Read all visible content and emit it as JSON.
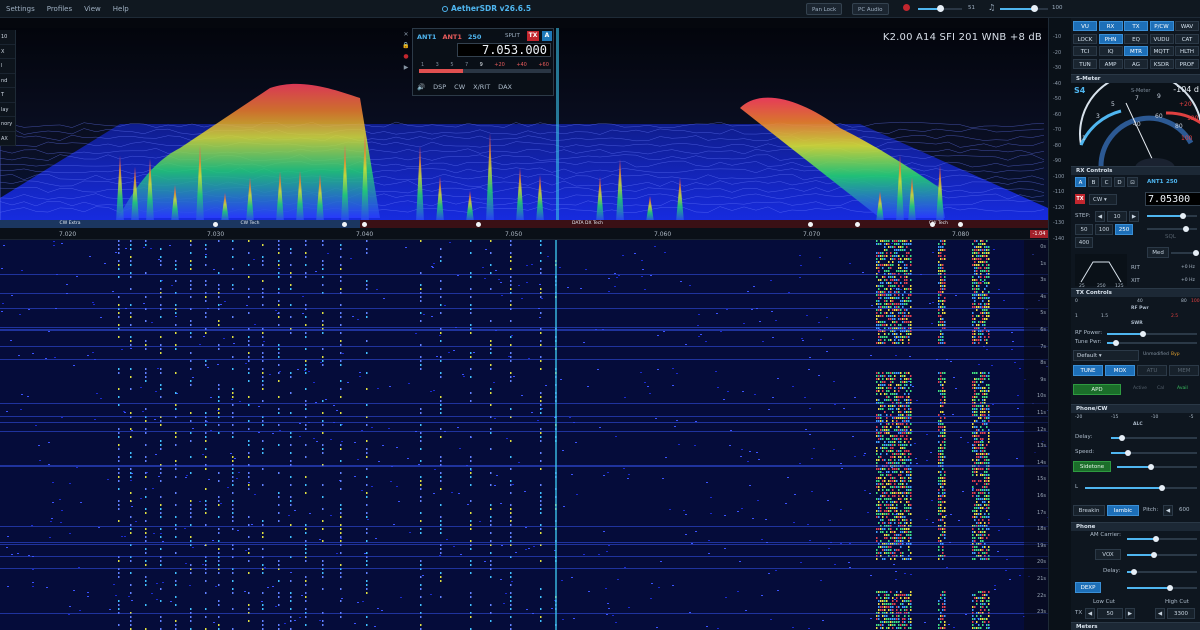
{
  "menu": {
    "items": [
      "Settings",
      "Profiles",
      "View",
      "Help"
    ],
    "title": "AetherSDR v26.6.5",
    "pan_lock": "Pan Lock",
    "pc_audio": "PC Audio",
    "volume1": "51",
    "volume2": "100"
  },
  "left_menu": [
    "10",
    "X",
    "l",
    "nd",
    "T",
    "lay",
    "nory",
    "AX"
  ],
  "pan_info": "K2.00  A14  SFI 201  WNB  +8 dB",
  "slice": {
    "ant_rx": "ANT1",
    "ant_tx": "ANT1",
    "filter": "250",
    "split": "SPLIT",
    "tx": "TX",
    "letter": "A",
    "frequency": "7.053.000",
    "smeter_labels": [
      "1",
      "3",
      "5",
      "7",
      "9",
      "+20",
      "+40",
      "+60"
    ],
    "tabs": [
      "DSP",
      "CW",
      "X/RIT",
      "DAX"
    ]
  },
  "bands": [
    {
      "label": "CW Extra",
      "color": "#1b3660"
    },
    {
      "label": "CW Tech",
      "color": "#1b3660"
    },
    {
      "label": "DATA DX Tech",
      "color": "#3a1015"
    },
    {
      "label": "CW Tech",
      "color": "#3a1015"
    }
  ],
  "freq_scale": [
    "7.020",
    "7.030",
    "7.040",
    "7.050",
    "7.060",
    "7.070",
    "7.080"
  ],
  "scale_badge": "-1.04",
  "wf_times": [
    "0s",
    "1s",
    "3s",
    "4s",
    "5s",
    "6s",
    "7s",
    "8s",
    "9s",
    "10s",
    "11s",
    "12s",
    "13s",
    "14s",
    "15s",
    "16s",
    "17s",
    "18s",
    "19s",
    "20s",
    "21s",
    "22s",
    "23s"
  ],
  "rc_scale": [
    "-10",
    "-20",
    "-30",
    "-40",
    "-50",
    "-60",
    "-70",
    "-80",
    "-90",
    "-100",
    "-110",
    "-120",
    "-130",
    "-140"
  ],
  "applets": {
    "row1": [
      "VU",
      "RX",
      "TX",
      "P/CW",
      "WAV"
    ],
    "row2": [
      "LOCK",
      "PHN",
      "EQ",
      "VUDU",
      "CAT"
    ],
    "row3": [
      "TCI",
      "IQ",
      "MTR",
      "MQTT",
      "HLTH"
    ],
    "row4": [
      "TUN",
      "AMP",
      "AG",
      "KSDR",
      "PROF"
    ]
  },
  "smeter": {
    "header": "S-Meter",
    "reading": "S4",
    "dbm": "-104 d",
    "center_label": "S-Meter",
    "scale": [
      "1",
      "3",
      "5",
      "7",
      "9",
      "+20",
      "40",
      "60",
      "80",
      "100",
      "120"
    ]
  },
  "rx": {
    "header": "RX Controls",
    "ant": "ANT1",
    "filter": "250",
    "mode": "CW",
    "frequency": "7.05300",
    "step_label": "STEP:",
    "step_value": "10",
    "filters": [
      "50",
      "100",
      "250",
      "400"
    ],
    "sql": "SQL",
    "agc": "Med",
    "rit": "RIT",
    "xit": "XIT",
    "rit_val": "+0 Hz",
    "xit_val": "+0 Hz",
    "filter_labels": [
      "25",
      "250",
      "125"
    ]
  },
  "tx": {
    "header": "TX Controls",
    "scale_top": [
      "0",
      "40",
      "80",
      "100"
    ],
    "rfpwr": "RF Pwr",
    "swr_scale": [
      "1",
      "1.5",
      "2.5"
    ],
    "swr": "SWR",
    "rf_power": "RF Power:",
    "tune_pwr": "Tune Pwr:",
    "profile": "Default",
    "extra": [
      "Unmodified",
      "Byp"
    ],
    "buttons": [
      "TUNE",
      "MOX",
      "ATU",
      "MEM"
    ],
    "apd": "APD",
    "apd_extra": [
      "Active",
      "Cal",
      "Avail"
    ]
  },
  "phone_cw": {
    "header": "Phone/CW",
    "scale": [
      "-20",
      "-15",
      "-10",
      "-5"
    ],
    "alc": "ALC",
    "delay": "Delay:",
    "speed": "Speed:",
    "sidetone": "Sidetone",
    "l_label": "L",
    "breakin": "Breakin",
    "iambic": "Iambic",
    "pitch": "Pitch:",
    "pitch_val": "600"
  },
  "phone": {
    "header": "Phone",
    "am_carrier": "AM Carrier:",
    "vox": "VOX",
    "delay": "Delay:",
    "dexp": "DEXP",
    "low_cut": "Low Cut",
    "high_cut": "High Cut",
    "tx_label": "TX",
    "low_val": "50",
    "high_val": "3300"
  },
  "meters_header": "Meters"
}
